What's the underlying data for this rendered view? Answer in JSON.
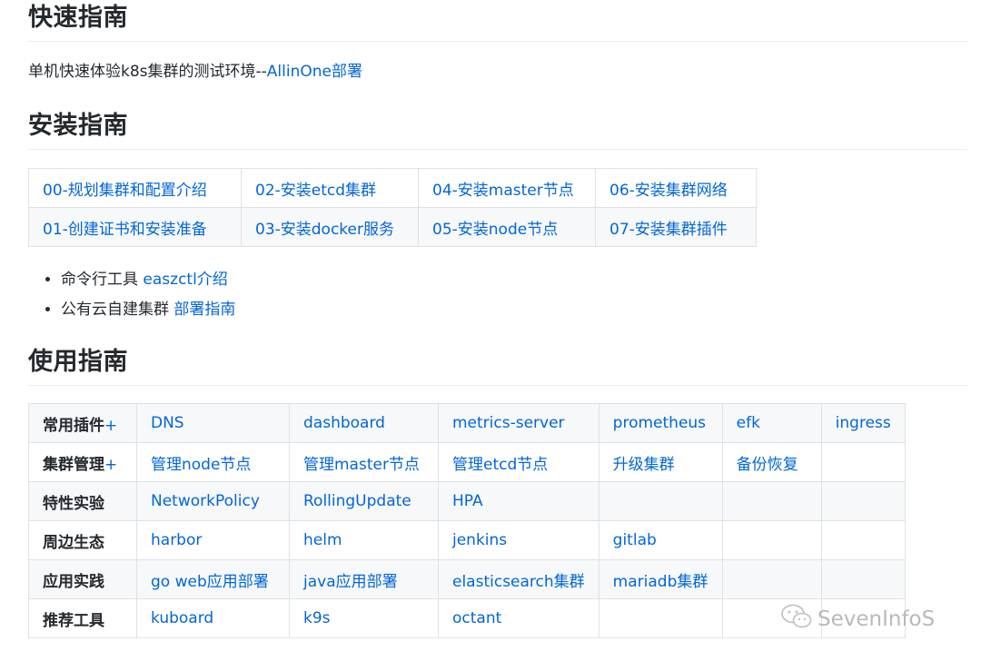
{
  "quick_guide": {
    "title": "快速指南",
    "intro_text": "单机快速体验k8s集群的测试环境--",
    "intro_link": "AllinOne部署"
  },
  "install_guide": {
    "title": "安装指南",
    "rows": [
      [
        "00-规划集群和配置介绍",
        "02-安装etcd集群",
        "04-安装master节点",
        "06-安装集群网络"
      ],
      [
        "01-创建证书和安装准备",
        "03-安装docker服务",
        "05-安装node节点",
        "07-安装集群插件"
      ]
    ],
    "bullets": [
      {
        "text": "命令行工具 ",
        "link": "easzctl介绍"
      },
      {
        "text": "公有云自建集群 ",
        "link": "部署指南"
      }
    ]
  },
  "usage_guide": {
    "title": "使用指南",
    "rows": [
      {
        "header": "常用插件",
        "plus": "+",
        "cells": [
          "DNS",
          "dashboard",
          "metrics-server",
          "prometheus",
          "efk",
          "ingress"
        ]
      },
      {
        "header": "集群管理",
        "plus": "+",
        "cells": [
          "管理node节点",
          "管理master节点",
          "管理etcd节点",
          "升级集群",
          "备份恢复",
          ""
        ]
      },
      {
        "header": "特性实验",
        "plus": "",
        "cells": [
          "NetworkPolicy",
          "RollingUpdate",
          "HPA",
          "",
          "",
          ""
        ]
      },
      {
        "header": "周边生态",
        "plus": "",
        "cells": [
          "harbor",
          "helm",
          "jenkins",
          "gitlab",
          "",
          ""
        ]
      },
      {
        "header": "应用实践",
        "plus": "",
        "cells": [
          "go web应用部署",
          "java应用部署",
          "elasticsearch集群",
          "mariadb集群",
          "",
          ""
        ]
      },
      {
        "header": "推荐工具",
        "plus": "",
        "cells": [
          "kuboard",
          "k9s",
          "octant",
          "",
          "",
          ""
        ]
      }
    ]
  },
  "watermark": {
    "text": "SevenInfoS",
    "icon": "wechat-icon"
  },
  "colors": {
    "link": "#0366d6",
    "text": "#24292e",
    "border": "#dfe2e5",
    "alt_row": "#f6f8fa"
  }
}
